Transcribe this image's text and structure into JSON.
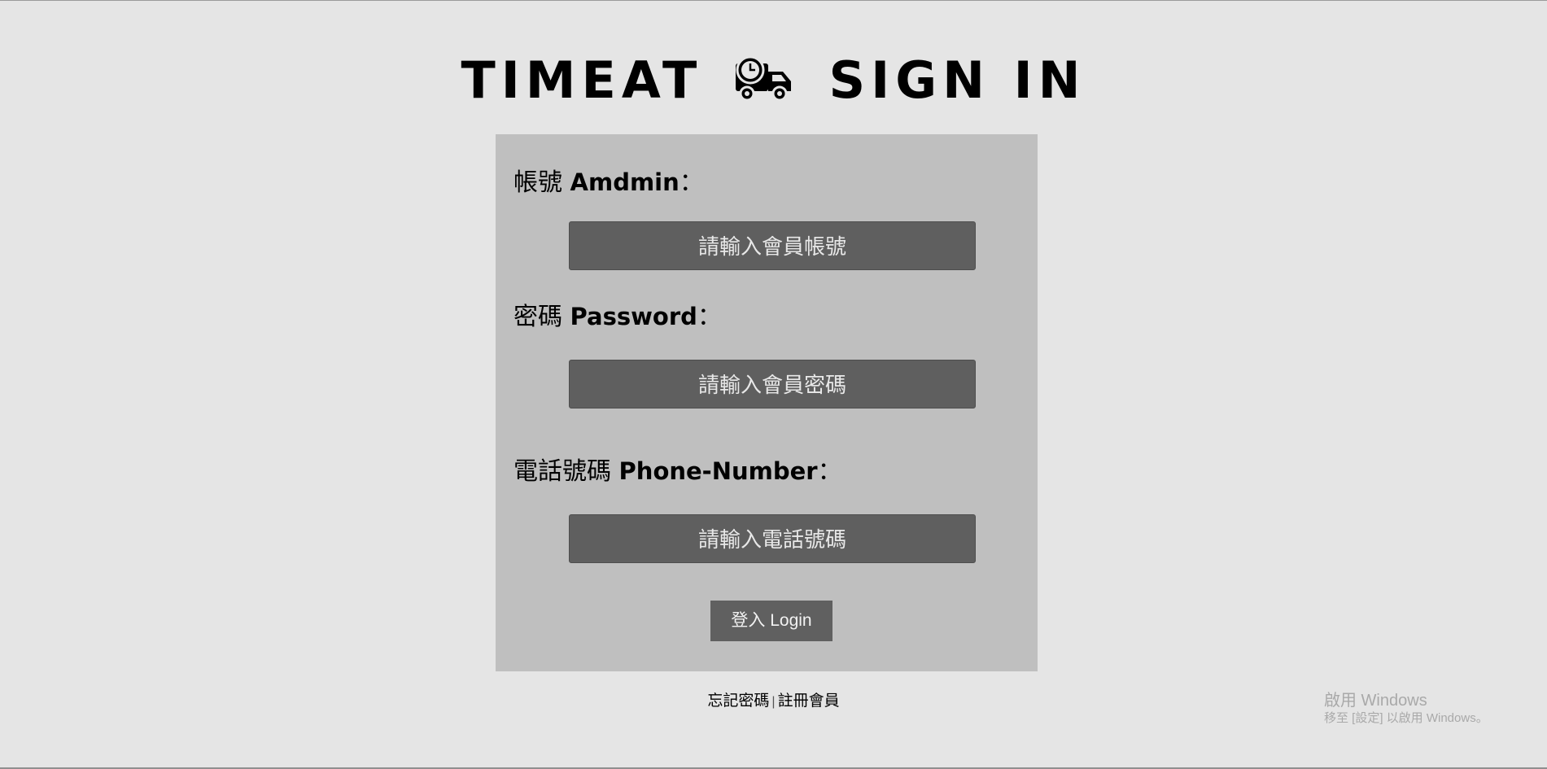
{
  "page": {
    "title_left": "TIMEAT",
    "title_right": "SIGN IN",
    "title_icon": "clock-truck-icon"
  },
  "form": {
    "account": {
      "label_zh": "帳號",
      "label_en": "Amdmin",
      "colon": "：",
      "placeholder": "請輸入會員帳號"
    },
    "password": {
      "label_zh": "密碼",
      "label_en": "Password",
      "colon": "：",
      "placeholder": "請輸入會員密碼"
    },
    "phone": {
      "label_zh": "電話號碼",
      "label_en": "Phone-Number",
      "colon": "：",
      "placeholder": "請輸入電話號碼"
    },
    "login_label": "登入 Login"
  },
  "footer": {
    "forgot_password": "忘記密碼",
    "separator": "|",
    "register": "註冊會員"
  },
  "watermark": {
    "line1": "啟用 Windows",
    "line2": "移至 [設定] 以啟用 Windows。"
  },
  "colors": {
    "background": "#e5e5e5",
    "panel": "#bfbfbf",
    "input": "#5f5f5f",
    "button": "#606060"
  }
}
